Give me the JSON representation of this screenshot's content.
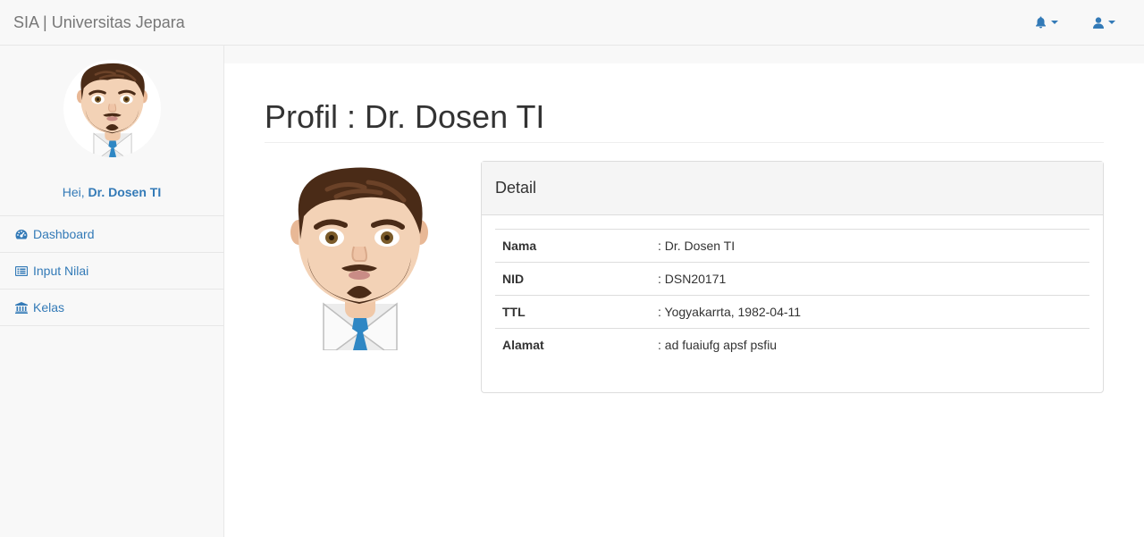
{
  "navbar": {
    "brand": "SIA | Universitas Jepara"
  },
  "sidebar": {
    "greeting": "Hei, ",
    "user_name": "Dr. Dosen TI",
    "items": [
      {
        "label": "Dashboard",
        "icon": "dashboard-icon"
      },
      {
        "label": "Input Nilai",
        "icon": "list-icon"
      },
      {
        "label": "Kelas",
        "icon": "institution-icon"
      }
    ]
  },
  "main": {
    "title": "Profil : Dr. Dosen TI",
    "panel_title": "Detail",
    "rows": [
      {
        "label": "Nama",
        "value": ": Dr. Dosen TI"
      },
      {
        "label": "NID",
        "value": ": DSN20171"
      },
      {
        "label": "TTL",
        "value": ": Yogyakarrta, 1982-04-11"
      },
      {
        "label": "Alamat",
        "value": ": ad fuaiufg apsf psfiu"
      }
    ]
  },
  "colors": {
    "link": "#337ab7",
    "brand": "#777777",
    "navbar_bg": "#f8f8f8"
  }
}
